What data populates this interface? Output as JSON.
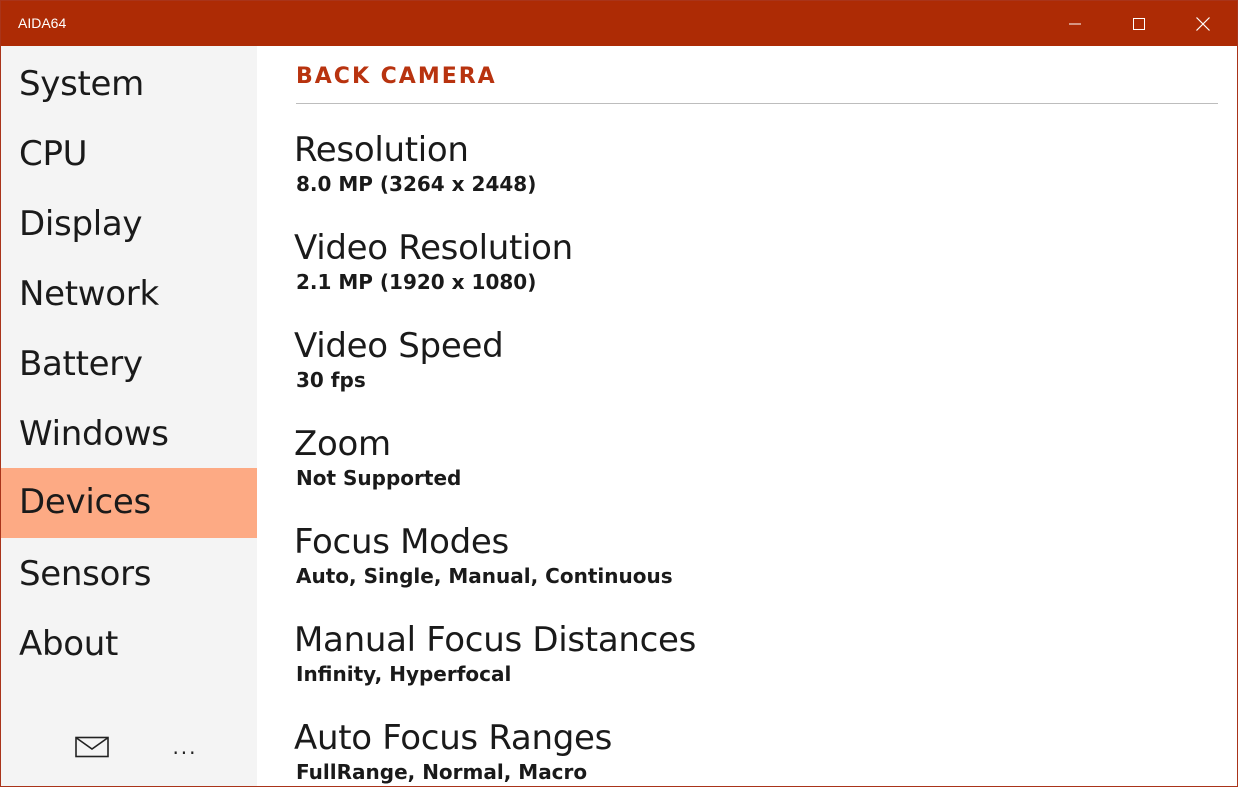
{
  "window": {
    "title": "AIDA64",
    "controls": {
      "minimize": "minimize",
      "maximize": "maximize",
      "close": "close"
    }
  },
  "sidebar": {
    "items": [
      {
        "label": "System"
      },
      {
        "label": "CPU"
      },
      {
        "label": "Display"
      },
      {
        "label": "Network"
      },
      {
        "label": "Battery"
      },
      {
        "label": "Windows"
      },
      {
        "label": "Devices",
        "selected": true
      },
      {
        "label": "Sensors"
      },
      {
        "label": "About"
      }
    ],
    "footer": {
      "mail_icon": "mail-icon",
      "more_label": "..."
    }
  },
  "main": {
    "section_title": "BACK CAMERA",
    "properties": [
      {
        "name": "Resolution",
        "value": "8.0 MP (3264 x 2448)"
      },
      {
        "name": "Video Resolution",
        "value": "2.1 MP (1920 x 1080)"
      },
      {
        "name": "Video Speed",
        "value": "30 fps"
      },
      {
        "name": "Zoom",
        "value": "Not Supported"
      },
      {
        "name": "Focus Modes",
        "value": "Auto, Single, Manual, Continuous"
      },
      {
        "name": "Manual Focus Distances",
        "value": "Infinity, Hyperfocal"
      },
      {
        "name": "Auto Focus Ranges",
        "value": "FullRange, Normal, Macro"
      }
    ]
  },
  "colors": {
    "titlebar": "#ad2b05",
    "accent": "#b8330f",
    "selected_nav": "#fdaa84",
    "sidebar_bg": "#f4f4f4"
  }
}
